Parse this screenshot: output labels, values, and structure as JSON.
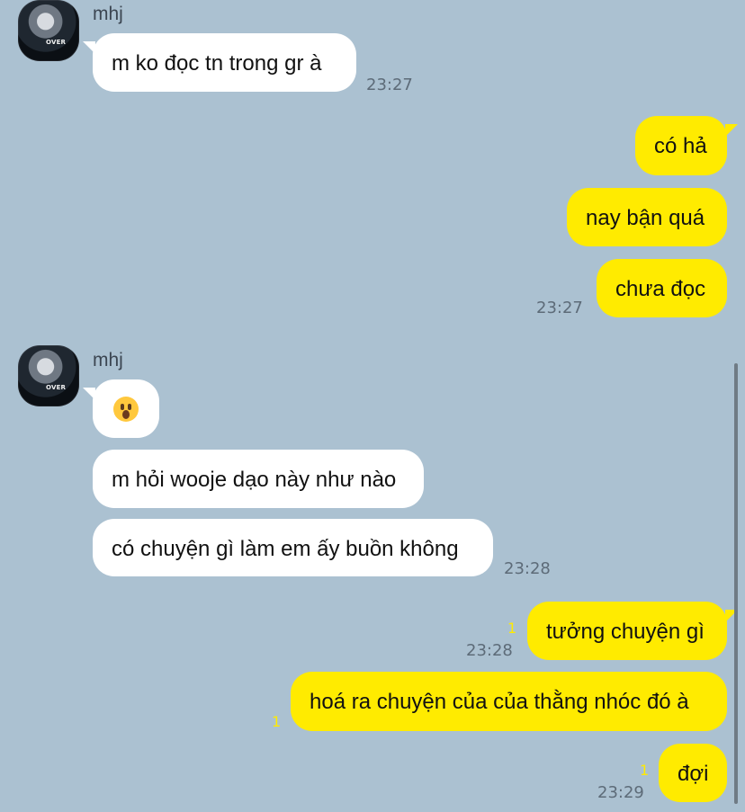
{
  "messages": [
    {
      "sender": "mhj",
      "items": [
        {
          "text": "m ko đọc tn trong gr à",
          "time": "23:27"
        }
      ]
    },
    {
      "outgoing": [
        {
          "text": "có hả"
        },
        {
          "text": "nay bận quá"
        },
        {
          "text": "chưa đọc",
          "time": "23:27"
        }
      ]
    },
    {
      "sender": "mhj",
      "items": [
        {
          "emoji": "surprised-face"
        },
        {
          "text": "m hỏi wooje dạo này như nào"
        },
        {
          "text": "có chuyện gì làm em ấy buồn không",
          "time": "23:28"
        }
      ]
    },
    {
      "outgoing": [
        {
          "text": "tưởng chuyện gì",
          "unread": "1",
          "time": "23:28"
        },
        {
          "text": "hoá ra chuyện của của thằng nhóc đó à",
          "unread": "1"
        },
        {
          "text": "đợi",
          "unread": "1",
          "time": "23:29"
        }
      ]
    }
  ],
  "avatar_badge": "OVER",
  "colors": {
    "background": "#abc1d1",
    "incoming_bubble": "#ffffff",
    "outgoing_bubble": "#ffeb00",
    "timestamp": "#5d6b78",
    "unread": "#ffea00"
  }
}
